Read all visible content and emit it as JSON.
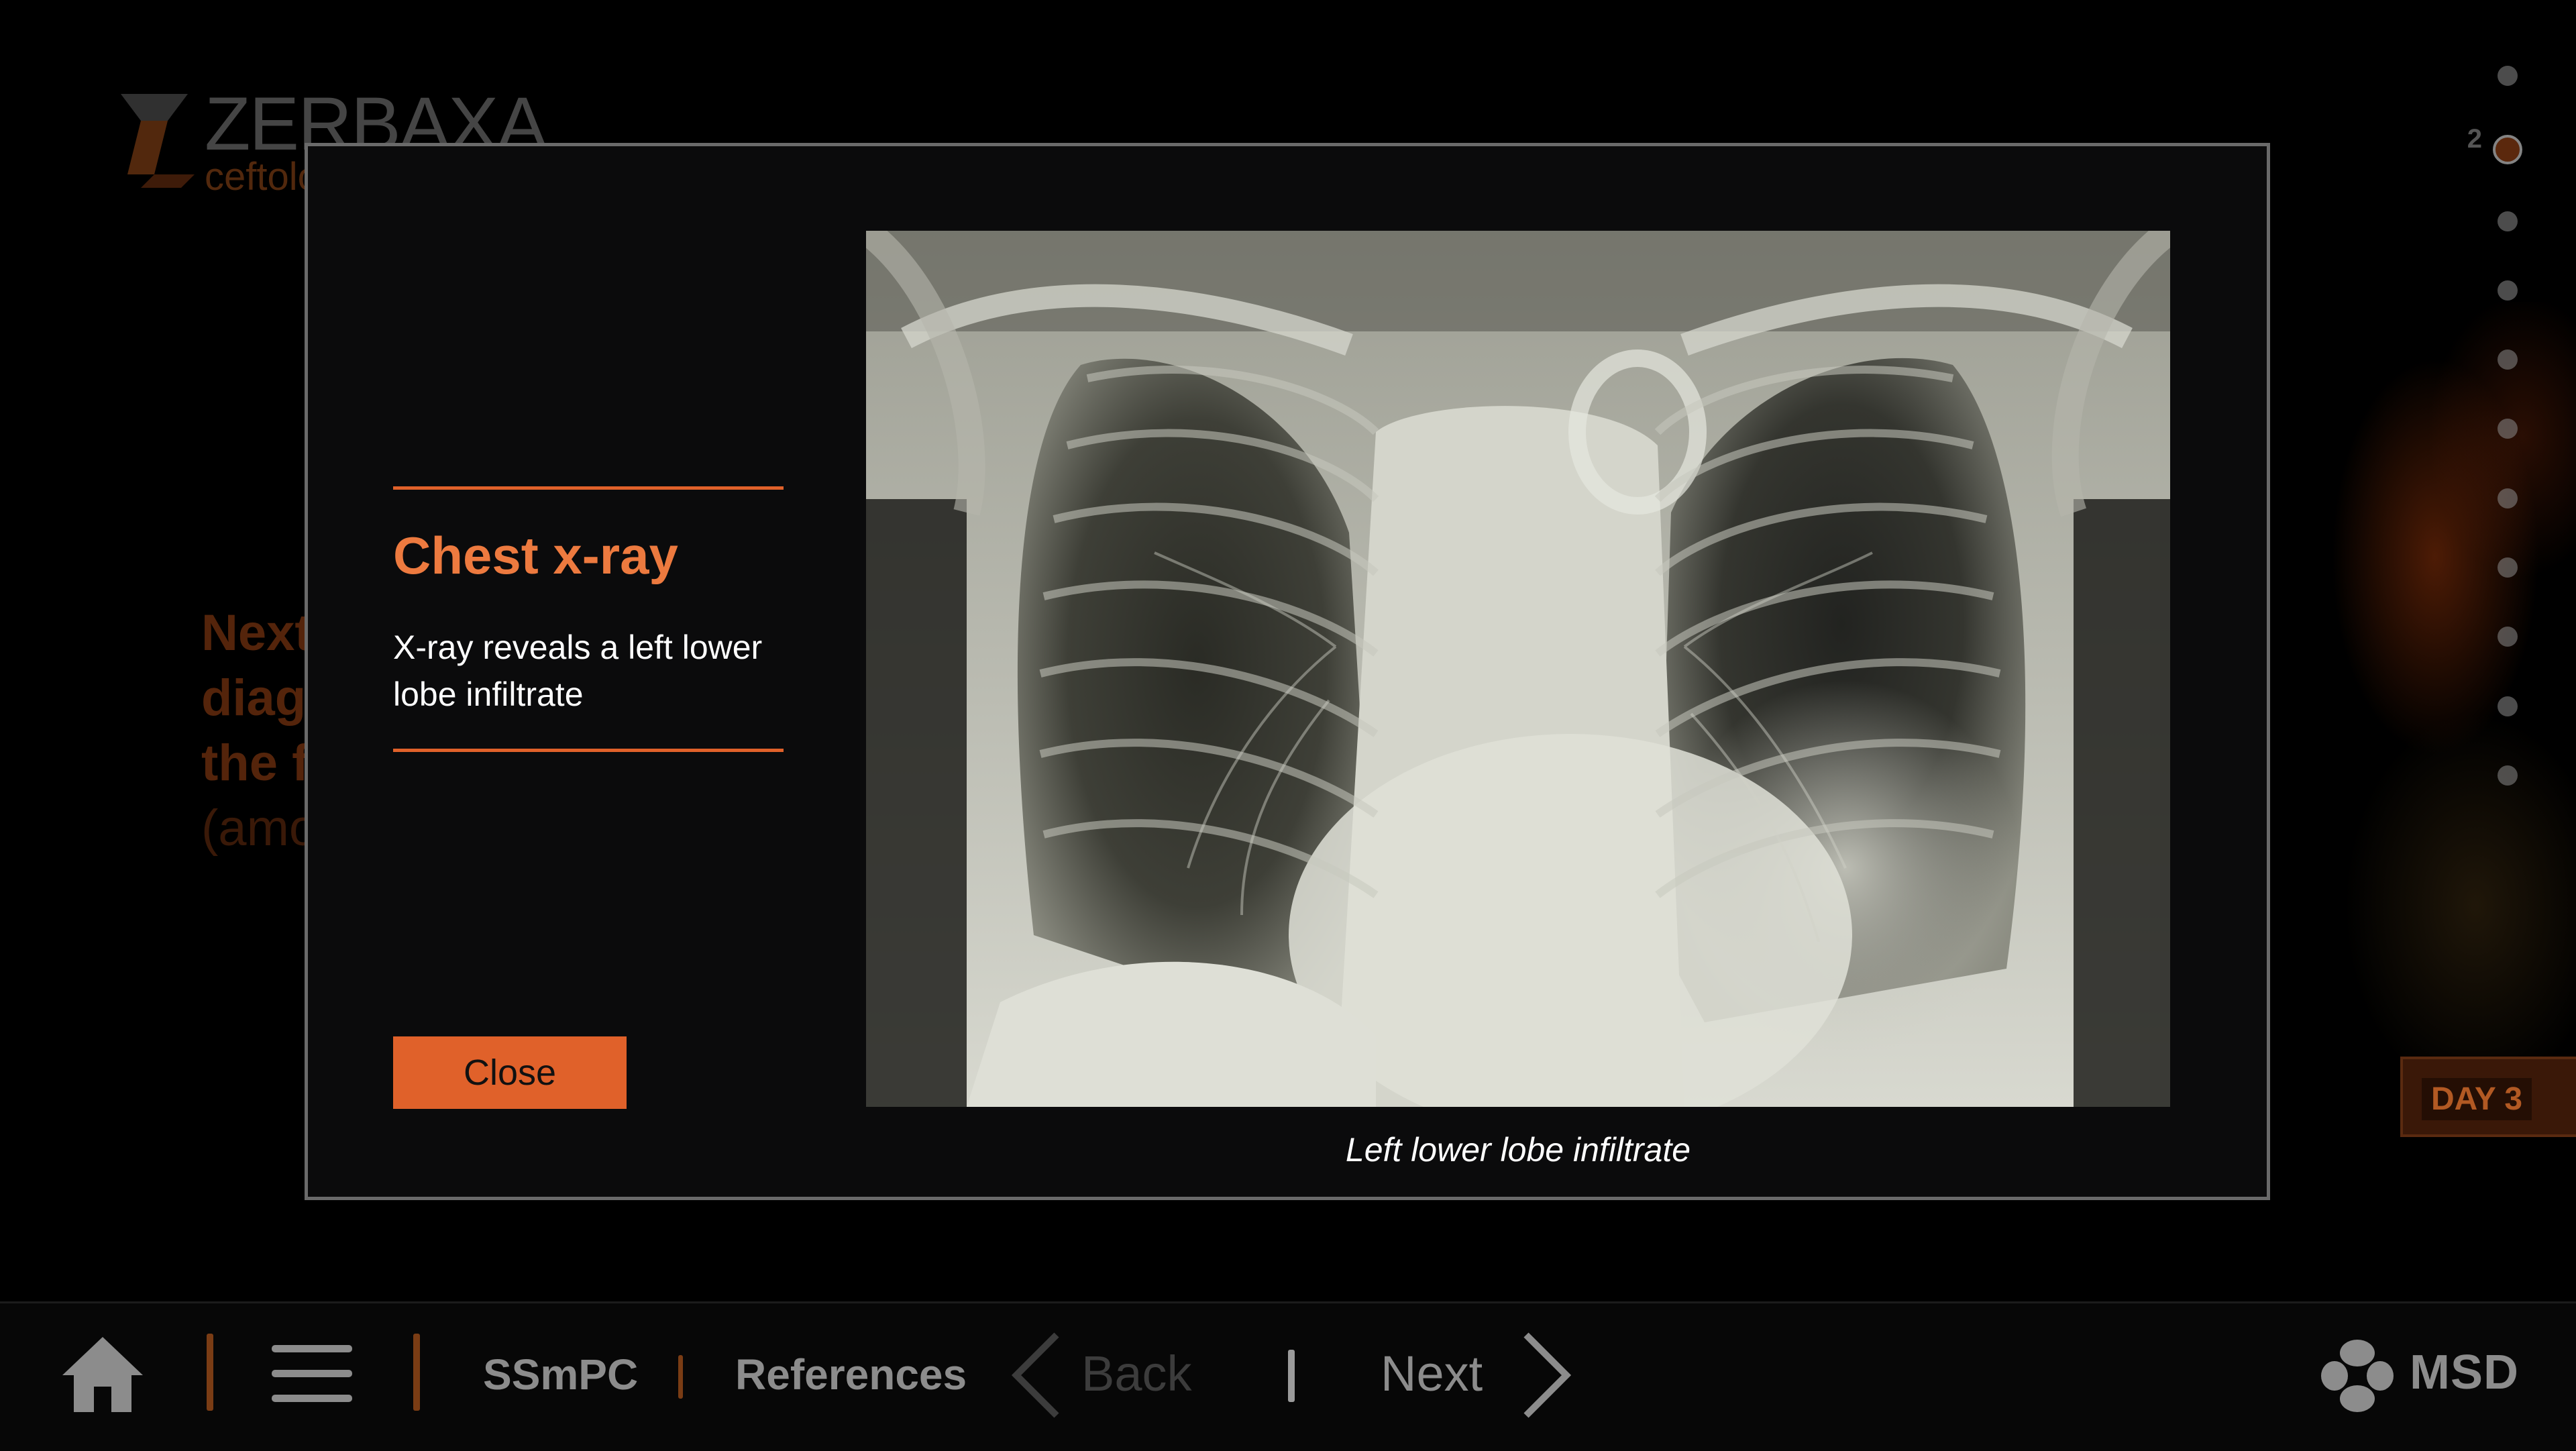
{
  "background": {
    "logo": {
      "brand": "ZERBAXA",
      "subtitle": "ceftoloz"
    },
    "question": {
      "lines": [
        "Next",
        "diag",
        "the f"
      ],
      "sub": "(amo"
    },
    "day_tab": "DAY 3"
  },
  "progress": {
    "active_index": 1,
    "active_label": "2",
    "dot_count": 11
  },
  "modal": {
    "title": "Chest x-ray",
    "body": "X-ray reveals a left lower lobe infiltrate",
    "close_label": "Close",
    "image_caption": "Left lower lobe infiltrate",
    "accent_color": "#e0612a"
  },
  "navbar": {
    "home_icon": "home-icon",
    "menu_icon": "hamburger-menu-icon",
    "ssmpc_label": "SSmPC",
    "references_label": "References",
    "back_label": "Back",
    "next_label": "Next",
    "brand_label": "MSD"
  }
}
